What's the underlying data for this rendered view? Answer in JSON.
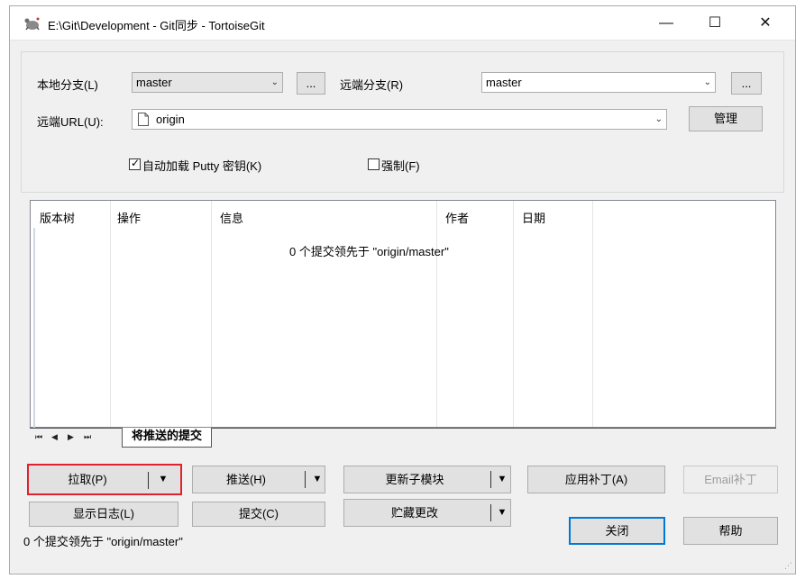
{
  "window": {
    "title": "E:\\Git\\Development - Git同步 - TortoiseGit",
    "minimize": "—",
    "maximize": "☐",
    "close": "✕"
  },
  "local_branch": {
    "label": "本地分支(L)",
    "value": "master",
    "browse": "..."
  },
  "remote_branch": {
    "label": "远端分支(R)",
    "value": "master",
    "browse": "..."
  },
  "remote_url": {
    "label": "远端URL(U):",
    "value": "origin",
    "manage": "管理"
  },
  "options": {
    "autoload_putty": "自动加载 Putty 密钥(K)",
    "autoload_checked": true,
    "force": "强制(F)",
    "force_checked": false
  },
  "list": {
    "columns": [
      "版本树",
      "操作",
      "信息",
      "作者",
      "日期"
    ],
    "empty_message": "0 个提交领先于 \"origin/master\""
  },
  "tabs": {
    "nav": [
      "⏮",
      "◀",
      "▶",
      "⏭"
    ],
    "active": "将推送的提交"
  },
  "actions": {
    "pull": "拉取(P)",
    "push": "推送(H)",
    "update_submodules": "更新子模块",
    "apply_patch": "应用补丁(A)",
    "email_patch": "Email补丁",
    "show_log": "显示日志(L)",
    "commit": "提交(C)",
    "stash": "贮藏更改",
    "close": "关闭",
    "help": "帮助"
  },
  "status": "0 个提交领先于 \"origin/master\"",
  "colors": {
    "highlight_border": "#e0212e",
    "focus_border": "#0078d7"
  }
}
